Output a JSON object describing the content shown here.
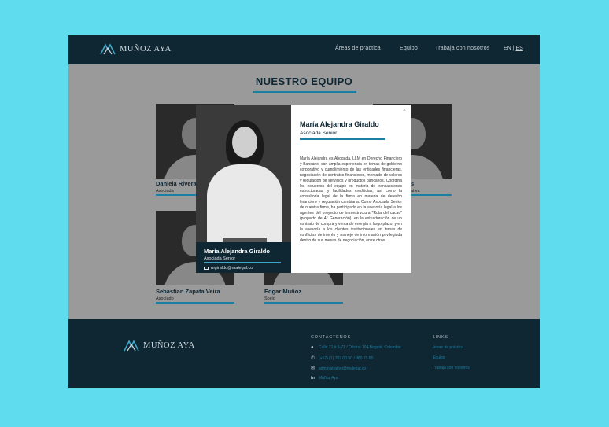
{
  "header": {
    "logo": "MUÑOZ AYA",
    "nav": [
      "Áreas de práctica",
      "Equipo",
      "Trabaja con nosotros"
    ],
    "lang_en": "EN",
    "lang_sep": "|",
    "lang_es": "ES"
  },
  "section_title": "NUESTRO EQUIPO",
  "team": [
    {
      "name": "Daniela Rivera",
      "role": "Asociada"
    },
    {
      "name": "s",
      "role": "ativa"
    },
    {
      "name": "Sebastian Zapata Veira",
      "role": "Asociado"
    },
    {
      "name": "Edgar Muñoz",
      "role": "Socio"
    }
  ],
  "modal": {
    "close": "×",
    "name": "María Alejandra Giraldo",
    "role": "Asociada Senior",
    "email": "mgiraldo@malegal.co",
    "bio": "María Alejandra es Abogada, LLM en Derecho Financiero y Bancario, con amplia experiencia en temas de gobierno corporativo y cumplimiento de las entidades financieras, negociación de contratos financieros, mercado de valores y regulación de servicios y productos bancarios. Coordina los esfuerzos del equipo en materia de transacciones estructuradas y facilidades crediticias, así como la consultoría legal de la firma en materia de derecho financiero y regulación cambiaria. Como Asociada Senior de nuestra firma, ha participado en la asesoría legal a los agentes del proyecto de infraestructura \"Ruta del cacao\" (proyecto de 4° Generación), en la estructuración de un contrato de compra y venta de energía a largo plazo, y en la asesoría a los clientes institucionales en temas de conflictos de interés y manejo de información privilegiada dentro de sus mesas de negociación, entre otros."
  },
  "footer": {
    "logo": "MUÑOZ AYA",
    "contact_heading": "CONTÁCTENOS",
    "address": "Calle 71 # 5-71 / Oficina 104 Bogotá, Colombia",
    "phone": "(+57) (1) 702 00 50 / 980 79 60",
    "email": "administrativo@malegal.co",
    "linkedin": "Muñoz Aya",
    "links_heading": "LINKS",
    "links": [
      "Áreas de práctica",
      "Equipo",
      "Trabaja con nosotros"
    ]
  },
  "colors": {
    "brand_dark": "#0f2633",
    "accent": "#1a7fa3",
    "background": "#5fdcee"
  }
}
